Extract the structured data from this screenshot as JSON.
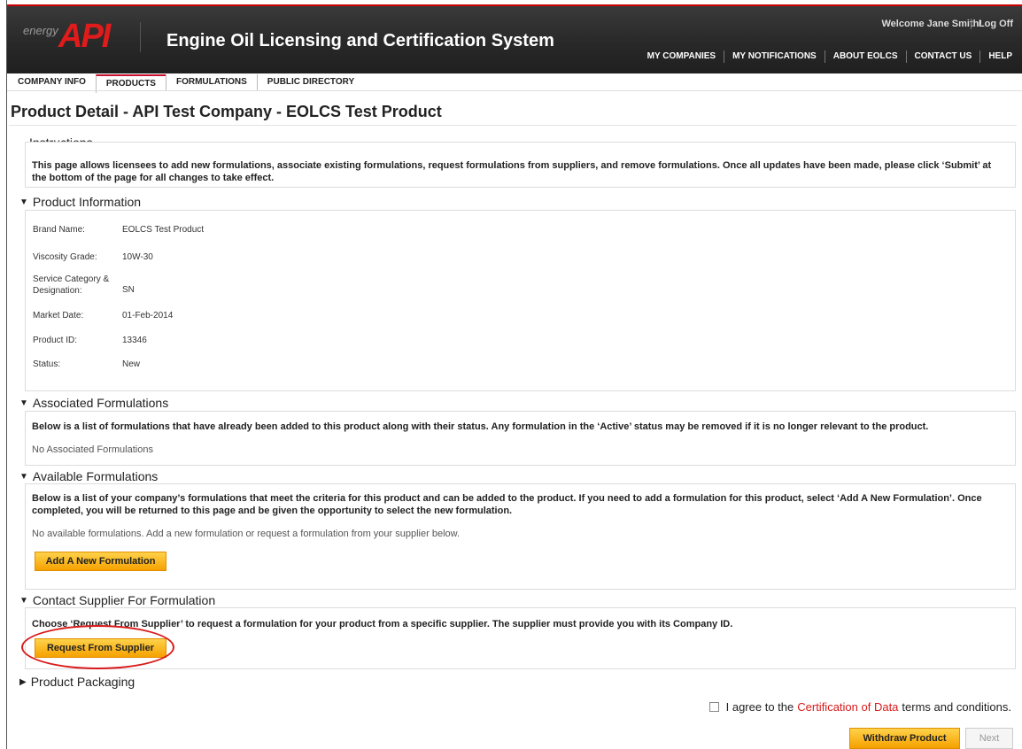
{
  "header": {
    "logo_energy": "energy",
    "logo_text": "API",
    "title": "Engine Oil Licensing and Certification System",
    "welcome": "Welcome Jane Smith!",
    "logoff": "Log Off",
    "nav": [
      "MY COMPANIES",
      "MY NOTIFICATIONS",
      "ABOUT EOLCS",
      "CONTACT US",
      "HELP"
    ]
  },
  "tabs": [
    "COMPANY INFO",
    "PRODUCTS",
    "FORMULATIONS",
    "PUBLIC DIRECTORY"
  ],
  "active_tab": "PRODUCTS",
  "page_title": "Product Detail - API Test Company - EOLCS Test Product",
  "instructions": {
    "title": "Instructions",
    "text": "This page allows licensees to add new formulations, associate existing formulations, request formulations from suppliers, and remove formulations. Once all updates have been made, please click ‘Submit’ at the bottom of the page for all changes to take effect."
  },
  "product_info": {
    "title": "Product Information",
    "fields": [
      {
        "label": "Brand Name:",
        "value": "EOLCS Test Product"
      },
      {
        "label": "Viscosity Grade:",
        "value": "10W-30"
      },
      {
        "label": "Service Category & Designation:",
        "value": "SN"
      },
      {
        "label": "Market Date:",
        "value": "01-Feb-2014"
      },
      {
        "label": "Product ID:",
        "value": "13346"
      },
      {
        "label": "Status:",
        "value": "New"
      }
    ]
  },
  "associated": {
    "title": "Associated Formulations",
    "text": "Below is a list of formulations that have already been added to this product along with their status. Any formulation in the ‘Active’ status may be removed if it is no longer relevant to the product.",
    "empty": "No Associated Formulations"
  },
  "available": {
    "title": "Available Formulations",
    "text": "Below is a list of your company’s formulations that meet the criteria for this product and can be added to the product. If you need to add a formulation for this product, select ‘Add A New Formulation’. Once completed, you will be returned to this page and be given the opportunity to select the new formulation.",
    "empty": "No available formulations. Add a new formulation or request a formulation from your supplier below.",
    "button": "Add A New Formulation"
  },
  "supplier": {
    "title": "Contact Supplier For Formulation",
    "text": "Choose ‘Request From Supplier’ to request a formulation for your product from a specific supplier. The supplier must provide you with its Company ID.",
    "button": "Request From Supplier"
  },
  "packaging": {
    "title": "Product Packaging"
  },
  "footer": {
    "agree_prefix": "I agree to the",
    "agree_link": "Certification of Data",
    "agree_suffix": "terms and conditions.",
    "withdraw": "Withdraw Product",
    "next": "Next"
  },
  "colors": {
    "brand_red": "#e01b1b",
    "button_orange": "#f5a100",
    "highlight_circle": "#d81a1a"
  }
}
